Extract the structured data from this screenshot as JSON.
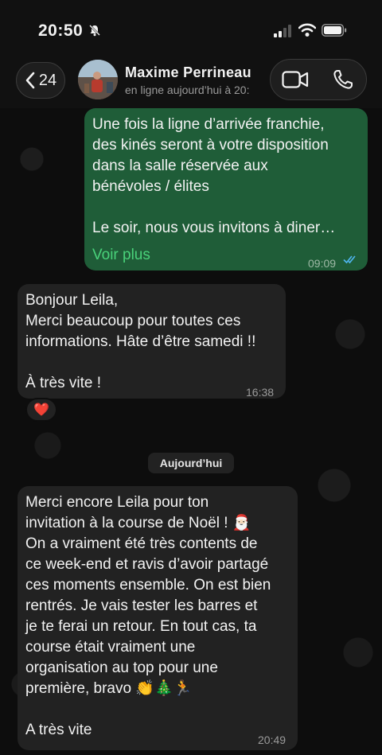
{
  "status_bar": {
    "time": "20:50"
  },
  "header": {
    "back_count": "24",
    "contact_name": "Maxime  Perrineau",
    "contact_status": "en ligne aujourd’hui à 20:"
  },
  "messages": [
    {
      "direction": "outgoing",
      "text": "Une fois la ligne d’arrivée franchie,\ndes kinés seront à votre disposition\ndans la salle réservée aux\nbénévoles / élites\n\nLe soir, nous vous invitons à diner…",
      "more_label": "Voir plus",
      "time": "09:09",
      "read": true
    },
    {
      "direction": "incoming",
      "text": "Bonjour Leila,\nMerci beaucoup pour toutes ces\ninformations. Hâte d’être samedi !!\n\nÀ très vite !",
      "time": "16:38",
      "reaction": "❤️"
    },
    {
      "direction": "incoming",
      "text": "Merci encore Leila pour ton\ninvitation à la course de Noël ! 🎅🏻\nOn a vraiment été très contents de\nce week-end et ravis d’avoir partagé\nces moments ensemble. On est bien\nrentrés. Je vais tester les barres et\nje te ferai un retour. En tout cas, ta\ncourse était vraiment une\norganisation au top pour une\npremière, bravo 👏🎄🏃\n\nA très vite",
      "time": "20:49"
    }
  ],
  "date_separator": "Aujourd’hui",
  "colors": {
    "outgoing_bubble": "#1f5d38",
    "incoming_bubble": "#222222",
    "read_ticks": "#4fb6f0",
    "voir_plus": "#49d27a"
  },
  "icons": [
    "bell-slash-icon",
    "signal-icon",
    "wifi-icon",
    "battery-icon",
    "chevron-left-icon",
    "video-camera-icon",
    "phone-icon",
    "double-check-icon"
  ]
}
